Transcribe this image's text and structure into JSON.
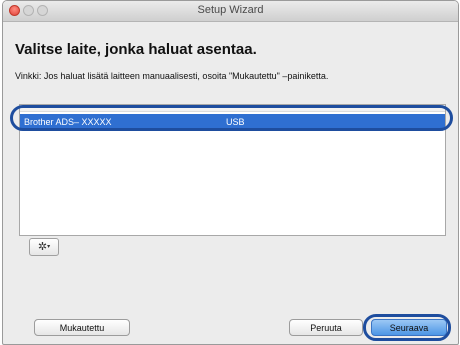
{
  "window": {
    "title": "Setup Wizard"
  },
  "heading": "Valitse laite, jonka haluat asentaa.",
  "hint": "Vinkki: Jos haluat lisätä laitteen manuaalisesti, osoita \"Mukautettu\" –painiketta.",
  "device_list": {
    "rows": [
      {
        "name": "Brother ADS– XXXXX",
        "connection": "USB",
        "selected": true
      }
    ]
  },
  "actions_menu": {
    "icon": "gear-icon",
    "caret": "▾"
  },
  "buttons": {
    "custom": "Mukautettu",
    "cancel": "Peruuta",
    "next": "Seuraava"
  },
  "colors": {
    "selection": "#2f6fd1",
    "callout": "#1e4d9e",
    "default_button": "#4d96e6"
  }
}
